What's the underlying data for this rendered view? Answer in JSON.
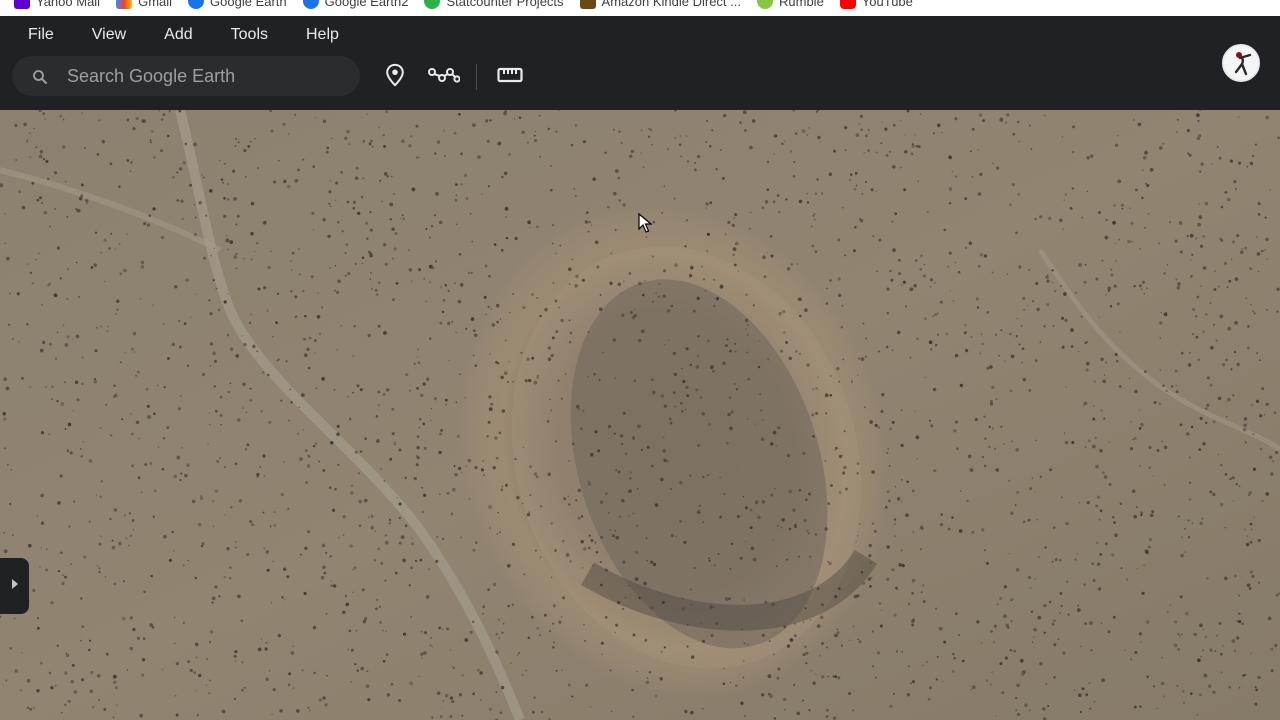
{
  "bookmarks": [
    {
      "label": "Yahoo Mail",
      "color": "#6001d2"
    },
    {
      "label": "Gmail",
      "color": "#ea4335"
    },
    {
      "label": "Google Earth",
      "color": "#1a73e8"
    },
    {
      "label": "Google Earth2",
      "color": "#1a73e8"
    },
    {
      "label": "Statcounter Projects",
      "color": "#2bb24c"
    },
    {
      "label": "Amazon Kindle Direct ...",
      "color": "#6b4a12"
    },
    {
      "label": "Rumble",
      "color": "#85c742"
    },
    {
      "label": "YouTube",
      "color": "#ff0000"
    }
  ],
  "menu": {
    "file": "File",
    "view": "View",
    "add": "Add",
    "tools": "Tools",
    "help": "Help"
  },
  "search": {
    "placeholder": "Search Google Earth",
    "icon": "search-icon"
  },
  "tools": {
    "placemark_icon": "placemark-icon",
    "path_icon": "path-icon",
    "measure_icon": "ruler-icon"
  },
  "colors": {
    "toolbar_bg": "#202124",
    "toolbar_text": "#e8eaed",
    "map_base": "#8a7d6a"
  }
}
